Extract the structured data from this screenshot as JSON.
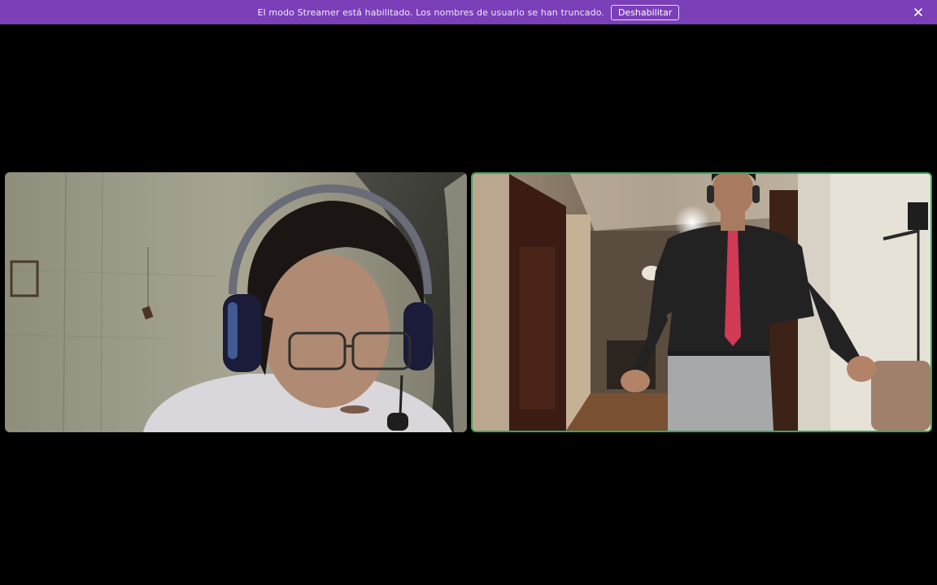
{
  "notice": {
    "text": "El modo Streamer está habilitado. Los nombres de usuario se han truncado.",
    "disable_label": "Deshabilitar",
    "close_icon": "close-icon",
    "background_color": "#7b3fb8"
  },
  "video_tiles": [
    {
      "name": "participant-video-1",
      "speaking": false
    },
    {
      "name": "participant-video-2",
      "speaking": true,
      "speaking_border_color": "#3ba55c"
    }
  ],
  "colors": {
    "stage_background": "#000000",
    "speaking_indicator": "#3ba55c"
  }
}
